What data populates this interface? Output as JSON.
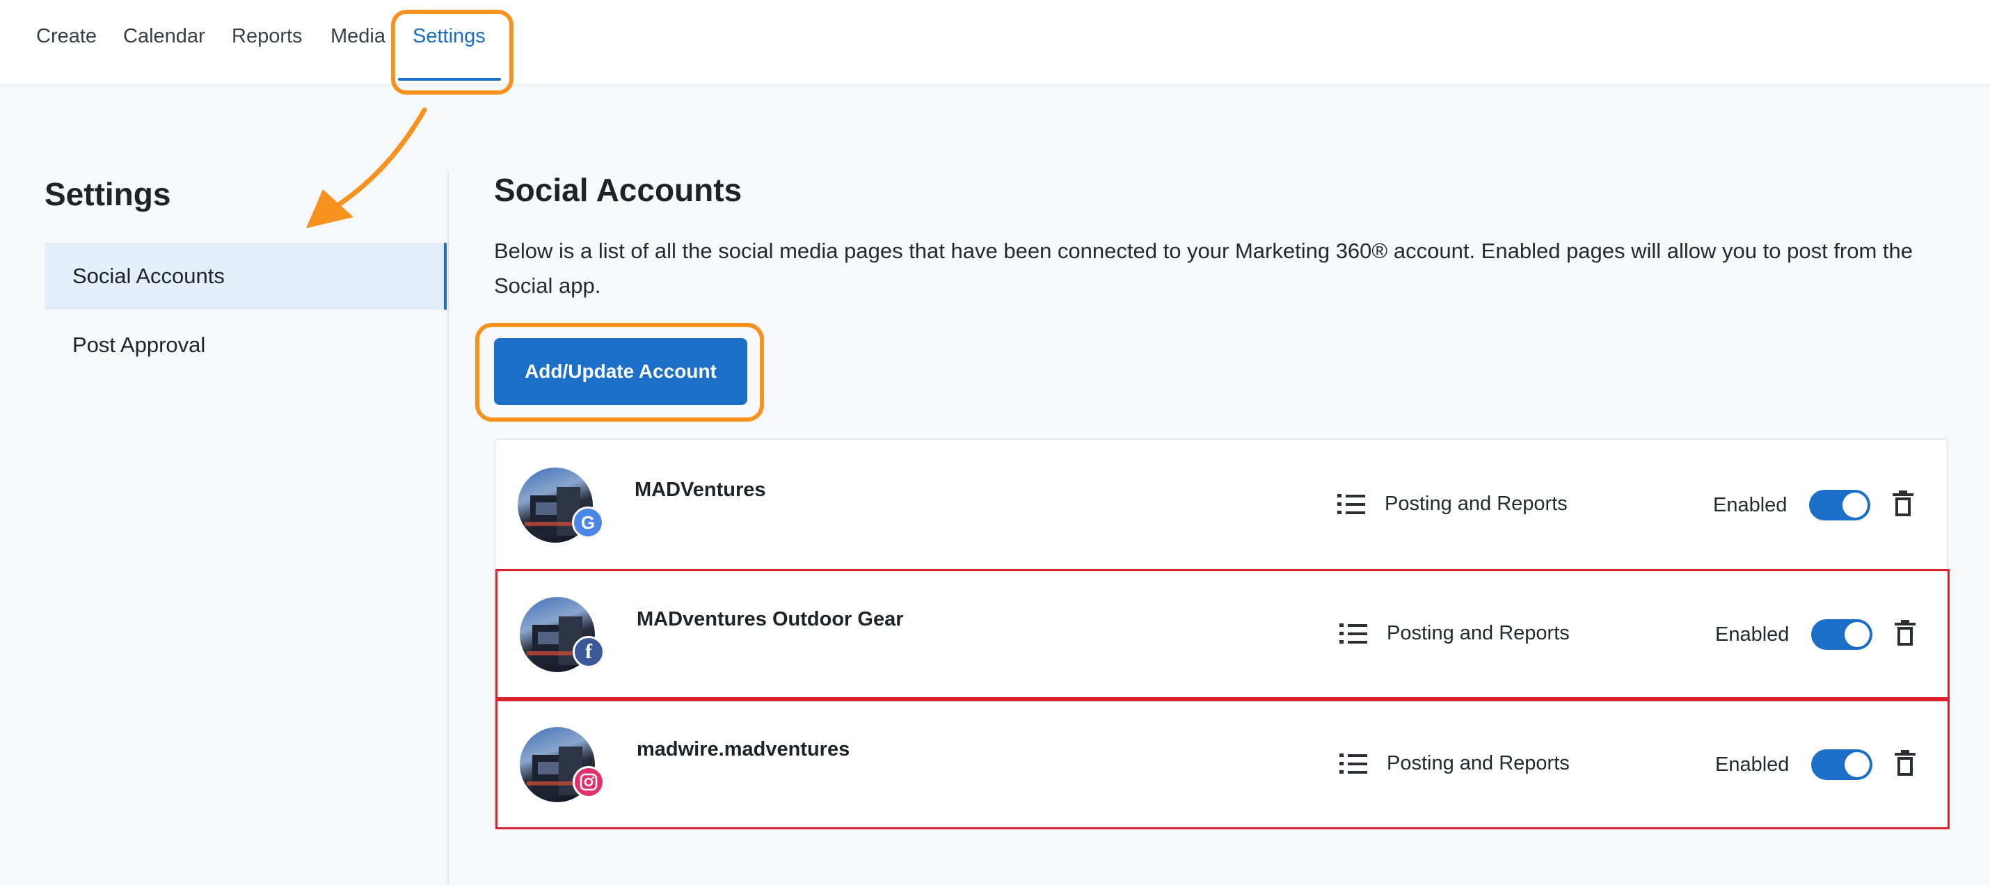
{
  "nav": {
    "tabs": [
      {
        "label": "Create"
      },
      {
        "label": "Calendar"
      },
      {
        "label": "Reports"
      },
      {
        "label": "Media"
      },
      {
        "label": "Settings",
        "active": true
      }
    ]
  },
  "sidebar": {
    "title": "Settings",
    "items": [
      {
        "label": "Social Accounts",
        "active": true
      },
      {
        "label": "Post Approval"
      }
    ]
  },
  "main": {
    "title": "Social Accounts",
    "description": "Below is a list of all the social media pages that have been connected to your Marketing 360® account. Enabled pages will allow you to post from the Social app.",
    "add_button": "Add/Update Account",
    "accounts": [
      {
        "name": "MADVentures",
        "network": "google",
        "badge_glyph": "G",
        "permission": "Posting and Reports",
        "status": "Enabled",
        "enabled": true,
        "highlighted": false
      },
      {
        "name": "MADventures Outdoor Gear",
        "network": "facebook",
        "badge_glyph": "f",
        "permission": "Posting and Reports",
        "status": "Enabled",
        "enabled": true,
        "highlighted": true
      },
      {
        "name": "madwire.madventures",
        "network": "instagram",
        "badge_glyph": "",
        "permission": "Posting and Reports",
        "status": "Enabled",
        "enabled": true,
        "highlighted": true
      }
    ]
  },
  "colors": {
    "accent": "#1b6fc8",
    "annotation": "#f7921e",
    "highlight_border": "#d9232d",
    "google": "#4a86e8",
    "facebook": "#3b5998",
    "instagram": "#e1306c"
  },
  "icons": [
    "arrow-annotation-icon",
    "google-icon",
    "facebook-icon",
    "instagram-icon",
    "list-icon",
    "trash-icon"
  ]
}
